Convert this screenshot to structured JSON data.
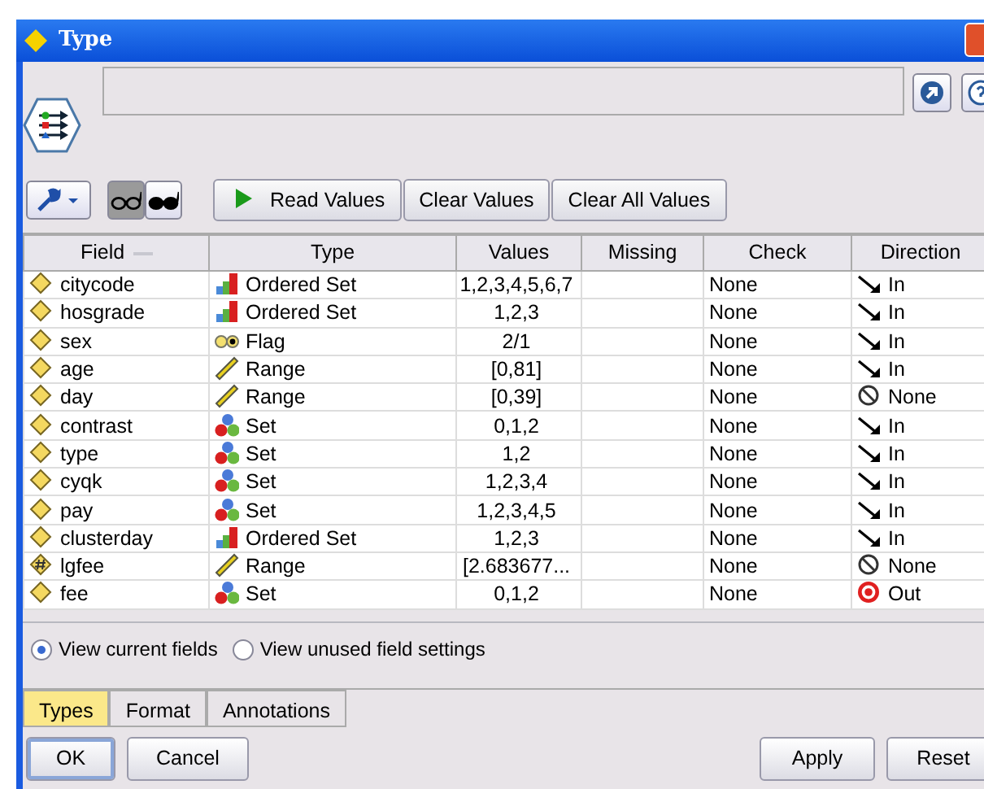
{
  "window": {
    "title": "Type"
  },
  "view_toggles": [
    {
      "selected": true
    },
    {
      "selected": false
    }
  ],
  "toolbar_buttons": [
    "Read Values",
    "Clear Values",
    "Clear All Values"
  ],
  "table": {
    "columns": [
      "Field",
      "Type",
      "Values",
      "Missing",
      "Check",
      "Direction"
    ],
    "rows": [
      {
        "field": {
          "name": "citycode",
          "kind": "plain"
        },
        "type": {
          "label": "Ordered Set",
          "kind": "ordered"
        },
        "values": "1,2,3,4,5,6,7",
        "check": "None",
        "direction": {
          "label": "In",
          "kind": "in"
        }
      },
      {
        "field": {
          "name": "hosgrade",
          "kind": "plain"
        },
        "type": {
          "label": "Ordered Set",
          "kind": "ordered"
        },
        "values": "1,2,3",
        "check": "None",
        "direction": {
          "label": "In",
          "kind": "in"
        }
      },
      {
        "field": {
          "name": "sex",
          "kind": "plain"
        },
        "type": {
          "label": "Flag",
          "kind": "flag"
        },
        "values": "2/1",
        "check": "None",
        "direction": {
          "label": "In",
          "kind": "in"
        }
      },
      {
        "field": {
          "name": "age",
          "kind": "plain"
        },
        "type": {
          "label": "Range",
          "kind": "range"
        },
        "values": "[0,81]",
        "check": "None",
        "direction": {
          "label": "In",
          "kind": "in"
        }
      },
      {
        "field": {
          "name": "day",
          "kind": "plain"
        },
        "type": {
          "label": "Range",
          "kind": "range"
        },
        "values": "[0,39]",
        "check": "None",
        "direction": {
          "label": "None",
          "kind": "none"
        }
      },
      {
        "field": {
          "name": "contrast",
          "kind": "plain"
        },
        "type": {
          "label": "Set",
          "kind": "set"
        },
        "values": "0,1,2",
        "check": "None",
        "direction": {
          "label": "In",
          "kind": "in"
        }
      },
      {
        "field": {
          "name": "type",
          "kind": "plain"
        },
        "type": {
          "label": "Set",
          "kind": "set"
        },
        "values": "1,2",
        "check": "None",
        "direction": {
          "label": "In",
          "kind": "in"
        }
      },
      {
        "field": {
          "name": "cyqk",
          "kind": "plain"
        },
        "type": {
          "label": "Set",
          "kind": "set"
        },
        "values": "1,2,3,4",
        "check": "None",
        "direction": {
          "label": "In",
          "kind": "in"
        }
      },
      {
        "field": {
          "name": "pay",
          "kind": "plain"
        },
        "type": {
          "label": "Set",
          "kind": "set"
        },
        "values": "1,2,3,4,5",
        "check": "None",
        "direction": {
          "label": "In",
          "kind": "in"
        }
      },
      {
        "field": {
          "name": "clusterday",
          "kind": "plain"
        },
        "type": {
          "label": "Ordered Set",
          "kind": "ordered"
        },
        "values": "1,2,3",
        "check": "None",
        "direction": {
          "label": "In",
          "kind": "in"
        }
      },
      {
        "field": {
          "name": "lgfee",
          "kind": "derived"
        },
        "type": {
          "label": "Range",
          "kind": "range"
        },
        "values": "[2.683677...",
        "check": "None",
        "direction": {
          "label": "None",
          "kind": "none"
        }
      },
      {
        "field": {
          "name": "fee",
          "kind": "plain"
        },
        "type": {
          "label": "Set",
          "kind": "set"
        },
        "values": "0,1,2",
        "check": "None",
        "direction": {
          "label": "Out",
          "kind": "out"
        }
      }
    ]
  },
  "view_options": [
    {
      "label": "View current fields",
      "selected": true
    },
    {
      "label": "View unused field settings",
      "selected": false
    }
  ],
  "tabs": [
    {
      "label": "Types",
      "selected": true
    },
    {
      "label": "Format",
      "selected": false
    },
    {
      "label": "Annotations",
      "selected": false
    }
  ],
  "footer_buttons": [
    {
      "label": "OK",
      "default": true
    },
    {
      "label": "Cancel",
      "default": false
    },
    {
      "label": "Apply",
      "default": false
    },
    {
      "label": "Reset",
      "default": false
    }
  ]
}
